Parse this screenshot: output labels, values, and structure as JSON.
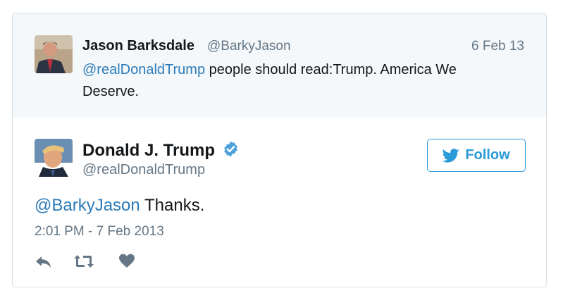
{
  "parent_tweet": {
    "name": "Jason Barksdale",
    "handle": "@BarkyJason",
    "date": "6 Feb 13",
    "mention": "@realDonaldTrump",
    "text": " people should read:Trump. America We Deserve."
  },
  "main_tweet": {
    "name": "Donald J. Trump",
    "handle": "@realDonaldTrump",
    "verified_icon": "verified-badge-icon",
    "mention": "@BarkyJason",
    "text": " Thanks.",
    "timestamp": "2:01 PM - 7 Feb 2013"
  },
  "follow_button": {
    "label": "Follow",
    "icon": "twitter-bird-icon"
  },
  "actions": [
    "reply-icon",
    "retweet-icon",
    "heart-icon"
  ],
  "colors": {
    "link": "#2b7bb9",
    "follow_accent": "#2b9ad8",
    "verified": "#4ea3dd",
    "muted": "#657786",
    "parent_bg": "#f5f8fa"
  }
}
